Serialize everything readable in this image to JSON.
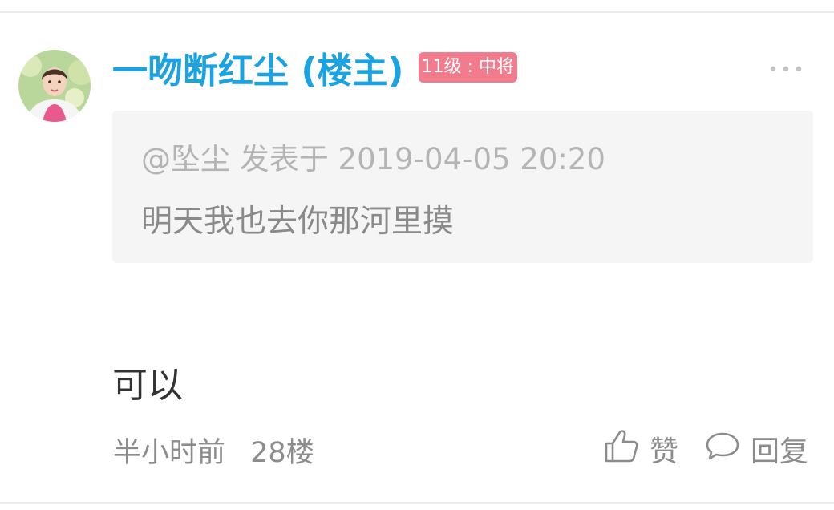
{
  "post": {
    "username": "一吻断红尘 (楼主)",
    "level_badge": "11级 : 中将",
    "quote": {
      "meta": "@坠尘 发表于 2019-04-05 20:20",
      "text": "明天我也去你那河里摸"
    },
    "reply_text": "可以",
    "time": "半小时前",
    "floor": "28楼",
    "actions": {
      "like_label": "赞",
      "reply_label": "回复"
    }
  },
  "colors": {
    "username": "#1aa3e0",
    "badge_bg": "#f37b8e",
    "quote_bg": "#f5f5f5"
  },
  "icons": {
    "more": "more-dots-icon",
    "like": "thumbs-up-icon",
    "reply": "comment-bubble-icon"
  }
}
